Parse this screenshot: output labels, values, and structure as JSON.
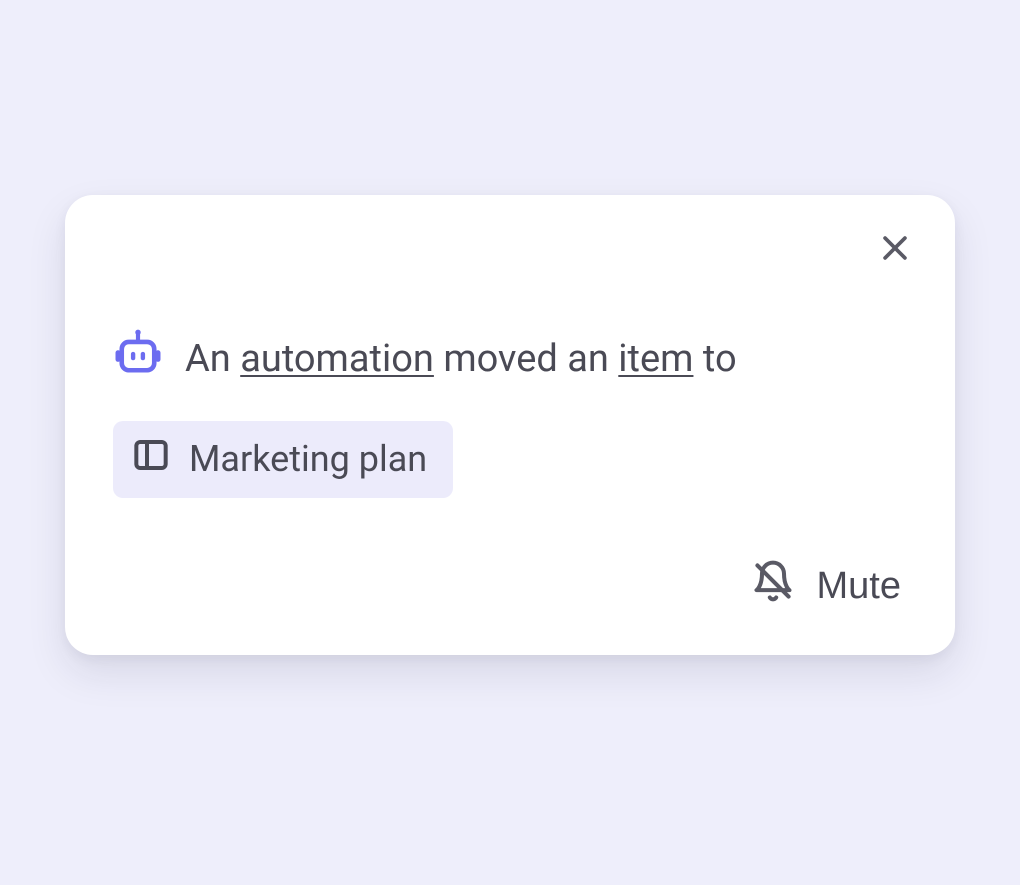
{
  "notification": {
    "message": {
      "prefix": "An ",
      "automation_link": "automation",
      "middle": " moved an ",
      "item_link": "item",
      "suffix": " to"
    },
    "board_chip": {
      "label": "Marketing plan"
    },
    "mute_label": "Mute"
  },
  "colors": {
    "background": "#eeeefb",
    "card": "#ffffff",
    "text": "#4a4a55",
    "chip_bg": "#ecebfb",
    "accent": "#6c6cf0"
  }
}
